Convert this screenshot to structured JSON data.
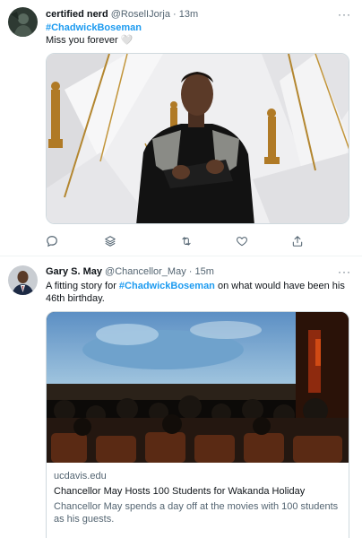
{
  "tweet1": {
    "name": "certified nerd",
    "handle": "@RoselIJorja",
    "dot": "·",
    "time": "13m",
    "more": "···",
    "hashtag": "#ChadwickBoseman",
    "line2": "Miss you forever",
    "heart": "🤍",
    "icons": [
      "reply-icon",
      "layers-icon",
      "retweet-icon",
      "like-icon",
      "share-icon"
    ]
  },
  "tweet2": {
    "name": "Gary S. May",
    "handle": "@Chancellor_May",
    "dot": "·",
    "time": "15m",
    "more": "···",
    "text_before": "A fitting story for ",
    "hashtag": "#ChadwickBoseman",
    "text_after": " on what would have been his 46th birthday.",
    "card": {
      "domain": "ucdavis.edu",
      "title": "Chancellor May Hosts 100 Students for Wakanda Holiday",
      "description": "Chancellor May spends a day off at the movies with 100 students as his guests."
    }
  },
  "colors": {
    "accent": "#1d9bf0",
    "muted": "#536471",
    "text": "#0f1419",
    "border": "#cfd9de"
  }
}
